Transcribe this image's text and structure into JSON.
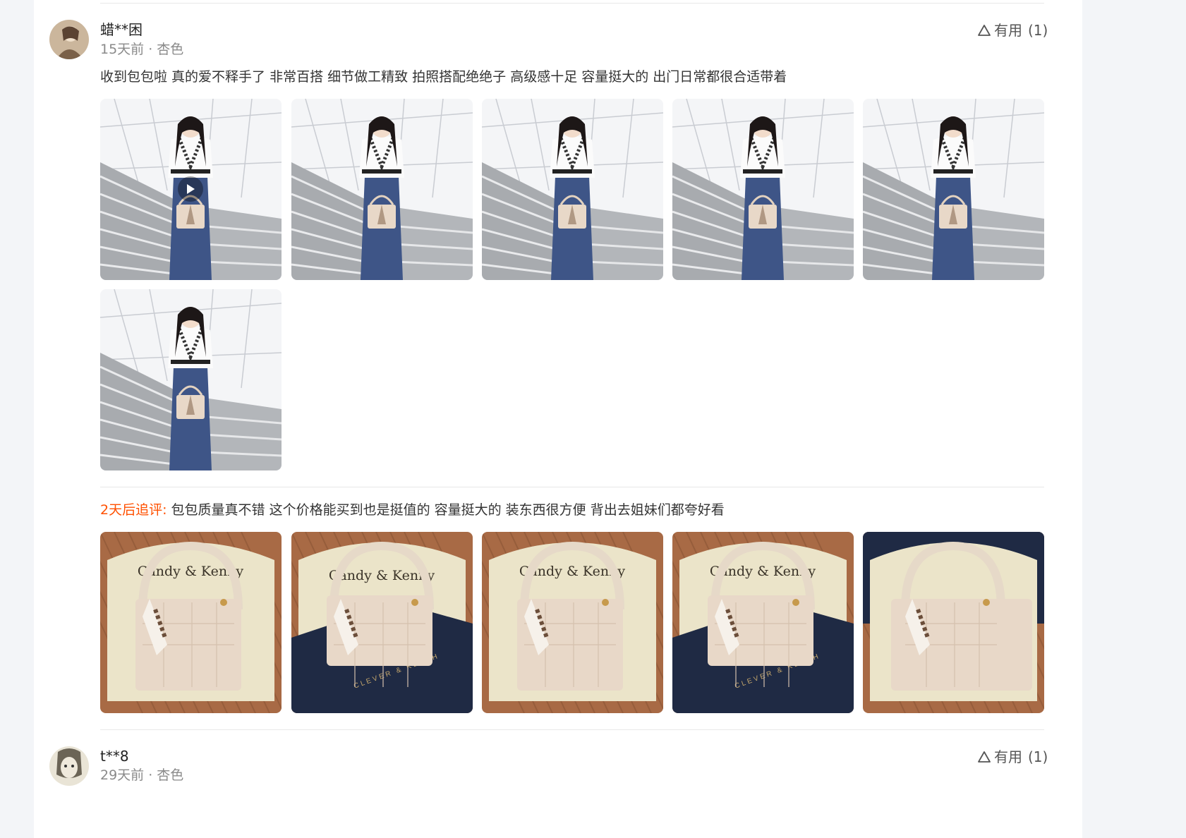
{
  "reviews": [
    {
      "username": "蜡**困",
      "meta": "15天前 · 杏色",
      "useful_label": "有用",
      "useful_count": "(1)",
      "text": "收到包包啦 真的爱不释手了 非常百搭 细节做工精致 拍照搭配绝绝子 高级感十足 容量挺大的 出门日常都很合适带着",
      "followup_label": "2天后追评:",
      "followup_text": "包包质量真不错 这个价格能买到也是挺值的 容量挺大的 装东西很方便 背出去姐妹们都夸好看",
      "bag_brand_text": "Candy & Kenny",
      "box_brand_text": "CLEVER & KETCH"
    },
    {
      "username": "t**8",
      "meta": "29天前 · 杏色",
      "useful_label": "有用",
      "useful_count": "(1)"
    }
  ],
  "colors": {
    "accent_followup": "#ff5000",
    "meta_gray": "#8a8a8a",
    "jeans_blue": "#3e5587",
    "bag_beige": "#e8d8c8",
    "box_navy": "#1f2a44"
  },
  "icons": {
    "useful": "thumb-triangle-icon",
    "video": "play-icon"
  }
}
